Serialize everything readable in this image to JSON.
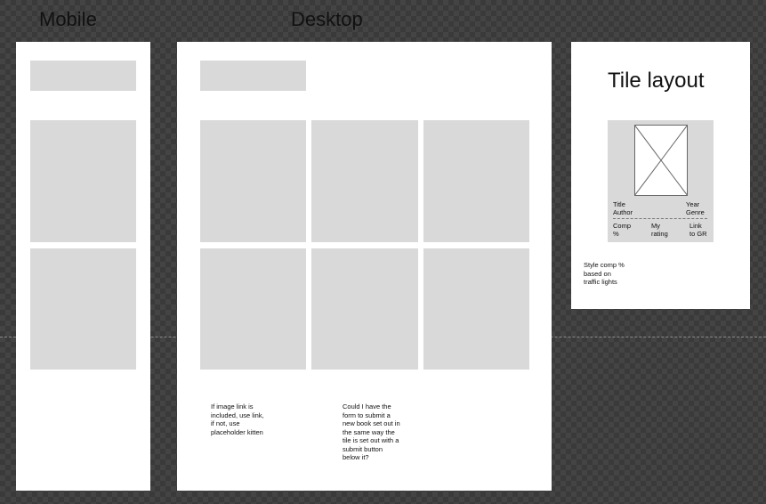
{
  "frames": {
    "mobile_title": "Mobile",
    "desktop_title": "Desktop"
  },
  "notes": {
    "image_link": "If image link is\nincluded, use link,\nif not, use\nplaceholder kitten",
    "form_request": "Could I have the\nform to submit a\nnew book set out in\nthe same way the\ntile is set out with a\nsubmit button\nbelow it?"
  },
  "tile_layout": {
    "heading": "Tile layout",
    "title_author": "Title\nAuthor",
    "year_genre": "Year\nGenre",
    "comp": "Comp\n%",
    "my_rating": "My\nrating",
    "link_gr": "Link\nto GR",
    "style_note": "Style comp %\nbased on\ntraffic lights"
  }
}
